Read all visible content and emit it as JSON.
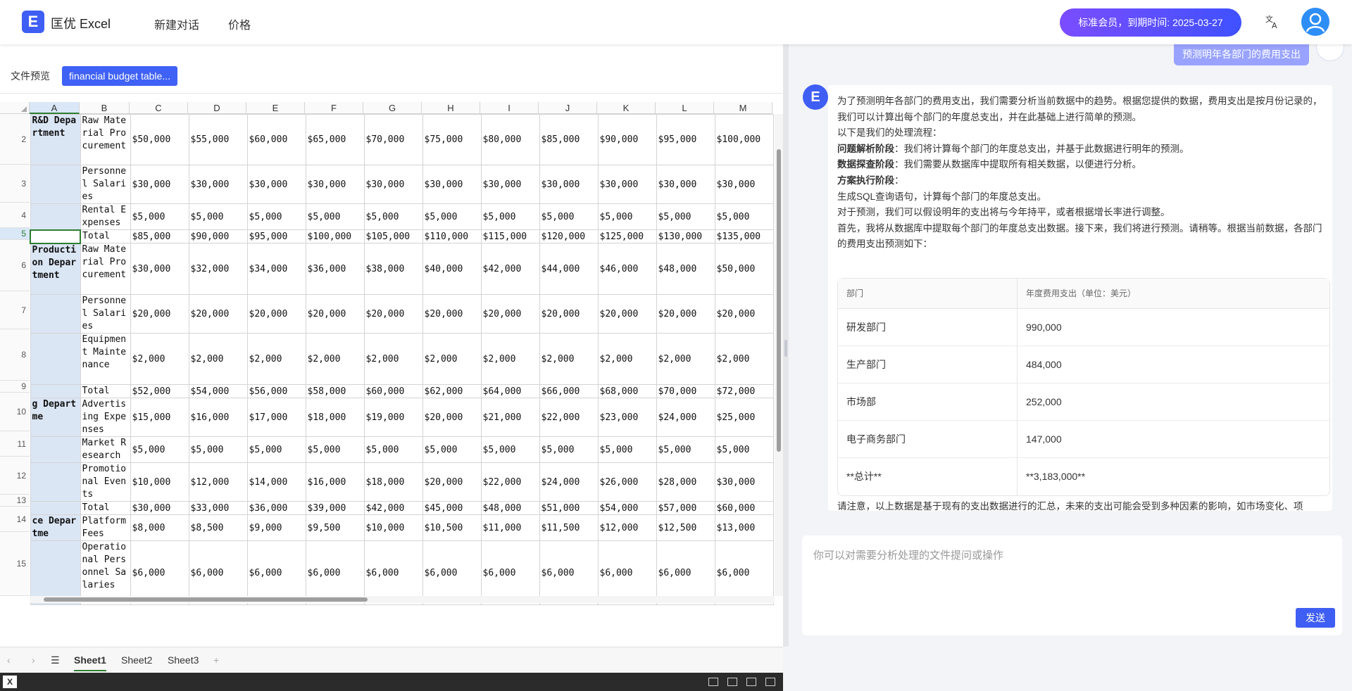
{
  "app": {
    "title": "匡优 Excel",
    "nav": [
      "新建对话",
      "价格"
    ],
    "membership": "标准会员，到期时间: 2025-03-27"
  },
  "preview": {
    "label": "文件预览",
    "file_name": "financial budget table..."
  },
  "sheet": {
    "columns": [
      "A",
      "B",
      "C",
      "D",
      "E",
      "F",
      "G",
      "H",
      "I",
      "J",
      "K",
      "L",
      "M"
    ],
    "row_numbers": [
      "2",
      "3",
      "4",
      "5",
      "6",
      "7",
      "8",
      "9",
      "10",
      "11",
      "12",
      "13",
      "14",
      "15"
    ],
    "rows": [
      {
        "a": "R&D Department",
        "b": "Raw Material Procurement",
        "vals": [
          "$50,000",
          "$55,000",
          "$60,000",
          "$65,000",
          "$70,000",
          "$75,000",
          "$80,000",
          "$85,000",
          "$90,000",
          "$95,000",
          "$100,000"
        ]
      },
      {
        "a": "",
        "b": "Personnel Salaries",
        "vals": [
          "$30,000",
          "$30,000",
          "$30,000",
          "$30,000",
          "$30,000",
          "$30,000",
          "$30,000",
          "$30,000",
          "$30,000",
          "$30,000",
          "$30,000"
        ]
      },
      {
        "a": "",
        "b": "Rental Expenses",
        "vals": [
          "$5,000",
          "$5,000",
          "$5,000",
          "$5,000",
          "$5,000",
          "$5,000",
          "$5,000",
          "$5,000",
          "$5,000",
          "$5,000",
          "$5,000"
        ]
      },
      {
        "a": "",
        "b": "Total",
        "vals": [
          "$85,000",
          "$90,000",
          "$95,000",
          "$100,000",
          "$105,000",
          "$110,000",
          "$115,000",
          "$120,000",
          "$125,000",
          "$130,000",
          "$135,000"
        ]
      },
      {
        "a": "Production Department",
        "b": "Raw Material Procurement",
        "vals": [
          "$30,000",
          "$32,000",
          "$34,000",
          "$36,000",
          "$38,000",
          "$40,000",
          "$42,000",
          "$44,000",
          "$46,000",
          "$48,000",
          "$50,000"
        ]
      },
      {
        "a": "",
        "b": "Personnel Salaries",
        "vals": [
          "$20,000",
          "$20,000",
          "$20,000",
          "$20,000",
          "$20,000",
          "$20,000",
          "$20,000",
          "$20,000",
          "$20,000",
          "$20,000",
          "$20,000"
        ]
      },
      {
        "a": "",
        "b": "Equipment Maintenance",
        "vals": [
          "$2,000",
          "$2,000",
          "$2,000",
          "$2,000",
          "$2,000",
          "$2,000",
          "$2,000",
          "$2,000",
          "$2,000",
          "$2,000",
          "$2,000"
        ]
      },
      {
        "a": "",
        "b": "Total",
        "vals": [
          "$52,000",
          "$54,000",
          "$56,000",
          "$58,000",
          "$60,000",
          "$62,000",
          "$64,000",
          "$66,000",
          "$68,000",
          "$70,000",
          "$72,000"
        ]
      },
      {
        "a": "g Departme",
        "b": "Advertising Expenses",
        "vals": [
          "$15,000",
          "$16,000",
          "$17,000",
          "$18,000",
          "$19,000",
          "$20,000",
          "$21,000",
          "$22,000",
          "$23,000",
          "$24,000",
          "$25,000"
        ]
      },
      {
        "a": "",
        "b": "Market Research",
        "vals": [
          "$5,000",
          "$5,000",
          "$5,000",
          "$5,000",
          "$5,000",
          "$5,000",
          "$5,000",
          "$5,000",
          "$5,000",
          "$5,000",
          "$5,000"
        ]
      },
      {
        "a": "",
        "b": "Promotional Events",
        "vals": [
          "$10,000",
          "$12,000",
          "$14,000",
          "$16,000",
          "$18,000",
          "$20,000",
          "$22,000",
          "$24,000",
          "$26,000",
          "$28,000",
          "$30,000"
        ]
      },
      {
        "a": "",
        "b": "Total",
        "vals": [
          "$30,000",
          "$33,000",
          "$36,000",
          "$39,000",
          "$42,000",
          "$45,000",
          "$48,000",
          "$51,000",
          "$54,000",
          "$57,000",
          "$60,000"
        ]
      },
      {
        "a": "ce Departme",
        "b": "Platform Fees",
        "vals": [
          "$8,000",
          "$8,500",
          "$9,000",
          "$9,500",
          "$10,000",
          "$10,500",
          "$11,000",
          "$11,500",
          "$12,000",
          "$12,500",
          "$13,000"
        ]
      },
      {
        "a": "",
        "b": "Operational Personnel Salaries",
        "vals": [
          "$6,000",
          "$6,000",
          "$6,000",
          "$6,000",
          "$6,000",
          "$6,000",
          "$6,000",
          "$6,000",
          "$6,000",
          "$6,000",
          "$6,000"
        ]
      }
    ],
    "tabs": [
      "Sheet1",
      "Sheet2",
      "Sheet3"
    ],
    "add_tab": "+"
  },
  "chat": {
    "user_message": "预测明年各部门的费用支出",
    "bot_paragraphs": [
      "为了预测明年各部门的费用支出，我们需要分析当前数据中的趋势。根据您提供的数据，费用支出是按月份记录的，我们可以计算出每个部门的年度总支出，并在此基础上进行简单的预测。",
      "以下是我们的处理流程：",
      "生成SQL查询语句，计算每个部门的年度总支出。",
      "对于预测，我们可以假设明年的支出将与今年持平，或者根据增长率进行调整。",
      "首先，我将从数据库中提取每个部门的年度总支出数据。接下来，我们将进行预测。请稍等。根据当前数据，各部门的费用支出预测如下："
    ],
    "steps": [
      {
        "title": "问题解析阶段",
        "text": "：我们将计算每个部门的年度总支出，并基于此数据进行明年的预测。"
      },
      {
        "title": "数据探查阶段",
        "text": "：我们需要从数据库中提取所有相关数据，以便进行分析。"
      },
      {
        "title": "方案执行阶段",
        "text": "："
      }
    ],
    "table_headers": [
      "部门",
      "年度费用支出（单位：美元）"
    ],
    "table_rows": [
      [
        "研发部门",
        "990,000"
      ],
      [
        "生产部门",
        "484,000"
      ],
      [
        "市场部",
        "252,000"
      ],
      [
        "电子商务部门",
        "147,000"
      ],
      [
        "**总计**",
        "**3,183,000**"
      ]
    ],
    "trailing_text": "请注意，以上数据是基于现有的支出数据进行的汇总，未来的支出可能会受到多种因素的影响，如市场变化、项",
    "input_placeholder": "你可以对需要分析处理的文件提问或操作",
    "send_label": "发送"
  },
  "icons": [
    "logo-icon",
    "translate-icon",
    "user-avatar-icon",
    "bot-avatar-icon",
    "menu-icon",
    "excel-icon"
  ],
  "colors": {
    "brand": "#3f5ef4",
    "vip_start": "#7b4dff",
    "vip_end": "#3f51ff",
    "user_bubble": "#99a3ff"
  }
}
